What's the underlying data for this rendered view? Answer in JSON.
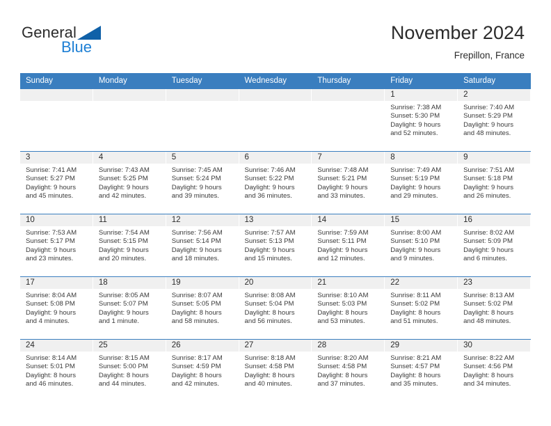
{
  "logo": {
    "word_general": "General",
    "word_blue": "Blue",
    "triangle_color": "#1061a8",
    "blue_color": "#1d7fd4"
  },
  "header": {
    "title": "November 2024",
    "subtitle": "Frepillon, France"
  },
  "theme": {
    "header_row_color": "#3a7ebf",
    "date_strip_color": "#f0f0f0",
    "text_color": "#2b2b2b"
  },
  "weekdays": [
    "Sunday",
    "Monday",
    "Tuesday",
    "Wednesday",
    "Thursday",
    "Friday",
    "Saturday"
  ],
  "labels": {
    "sunrise_prefix": "Sunrise:",
    "sunset_prefix": "Sunset:",
    "daylight_prefix": "Daylight:"
  },
  "weeks": [
    [
      {
        "date": "",
        "blank": true
      },
      {
        "date": "",
        "blank": true
      },
      {
        "date": "",
        "blank": true
      },
      {
        "date": "",
        "blank": true
      },
      {
        "date": "",
        "blank": true
      },
      {
        "date": "1",
        "sunrise": "Sunrise: 7:38 AM",
        "sunset": "Sunset: 5:30 PM",
        "daylight_1": "Daylight: 9 hours",
        "daylight_2": "and 52 minutes."
      },
      {
        "date": "2",
        "sunrise": "Sunrise: 7:40 AM",
        "sunset": "Sunset: 5:29 PM",
        "daylight_1": "Daylight: 9 hours",
        "daylight_2": "and 48 minutes."
      }
    ],
    [
      {
        "date": "3",
        "sunrise": "Sunrise: 7:41 AM",
        "sunset": "Sunset: 5:27 PM",
        "daylight_1": "Daylight: 9 hours",
        "daylight_2": "and 45 minutes."
      },
      {
        "date": "4",
        "sunrise": "Sunrise: 7:43 AM",
        "sunset": "Sunset: 5:25 PM",
        "daylight_1": "Daylight: 9 hours",
        "daylight_2": "and 42 minutes."
      },
      {
        "date": "5",
        "sunrise": "Sunrise: 7:45 AM",
        "sunset": "Sunset: 5:24 PM",
        "daylight_1": "Daylight: 9 hours",
        "daylight_2": "and 39 minutes."
      },
      {
        "date": "6",
        "sunrise": "Sunrise: 7:46 AM",
        "sunset": "Sunset: 5:22 PM",
        "daylight_1": "Daylight: 9 hours",
        "daylight_2": "and 36 minutes."
      },
      {
        "date": "7",
        "sunrise": "Sunrise: 7:48 AM",
        "sunset": "Sunset: 5:21 PM",
        "daylight_1": "Daylight: 9 hours",
        "daylight_2": "and 33 minutes."
      },
      {
        "date": "8",
        "sunrise": "Sunrise: 7:49 AM",
        "sunset": "Sunset: 5:19 PM",
        "daylight_1": "Daylight: 9 hours",
        "daylight_2": "and 29 minutes."
      },
      {
        "date": "9",
        "sunrise": "Sunrise: 7:51 AM",
        "sunset": "Sunset: 5:18 PM",
        "daylight_1": "Daylight: 9 hours",
        "daylight_2": "and 26 minutes."
      }
    ],
    [
      {
        "date": "10",
        "sunrise": "Sunrise: 7:53 AM",
        "sunset": "Sunset: 5:17 PM",
        "daylight_1": "Daylight: 9 hours",
        "daylight_2": "and 23 minutes."
      },
      {
        "date": "11",
        "sunrise": "Sunrise: 7:54 AM",
        "sunset": "Sunset: 5:15 PM",
        "daylight_1": "Daylight: 9 hours",
        "daylight_2": "and 20 minutes."
      },
      {
        "date": "12",
        "sunrise": "Sunrise: 7:56 AM",
        "sunset": "Sunset: 5:14 PM",
        "daylight_1": "Daylight: 9 hours",
        "daylight_2": "and 18 minutes."
      },
      {
        "date": "13",
        "sunrise": "Sunrise: 7:57 AM",
        "sunset": "Sunset: 5:13 PM",
        "daylight_1": "Daylight: 9 hours",
        "daylight_2": "and 15 minutes."
      },
      {
        "date": "14",
        "sunrise": "Sunrise: 7:59 AM",
        "sunset": "Sunset: 5:11 PM",
        "daylight_1": "Daylight: 9 hours",
        "daylight_2": "and 12 minutes."
      },
      {
        "date": "15",
        "sunrise": "Sunrise: 8:00 AM",
        "sunset": "Sunset: 5:10 PM",
        "daylight_1": "Daylight: 9 hours",
        "daylight_2": "and 9 minutes."
      },
      {
        "date": "16",
        "sunrise": "Sunrise: 8:02 AM",
        "sunset": "Sunset: 5:09 PM",
        "daylight_1": "Daylight: 9 hours",
        "daylight_2": "and 6 minutes."
      }
    ],
    [
      {
        "date": "17",
        "sunrise": "Sunrise: 8:04 AM",
        "sunset": "Sunset: 5:08 PM",
        "daylight_1": "Daylight: 9 hours",
        "daylight_2": "and 4 minutes."
      },
      {
        "date": "18",
        "sunrise": "Sunrise: 8:05 AM",
        "sunset": "Sunset: 5:07 PM",
        "daylight_1": "Daylight: 9 hours",
        "daylight_2": "and 1 minute."
      },
      {
        "date": "19",
        "sunrise": "Sunrise: 8:07 AM",
        "sunset": "Sunset: 5:05 PM",
        "daylight_1": "Daylight: 8 hours",
        "daylight_2": "and 58 minutes."
      },
      {
        "date": "20",
        "sunrise": "Sunrise: 8:08 AM",
        "sunset": "Sunset: 5:04 PM",
        "daylight_1": "Daylight: 8 hours",
        "daylight_2": "and 56 minutes."
      },
      {
        "date": "21",
        "sunrise": "Sunrise: 8:10 AM",
        "sunset": "Sunset: 5:03 PM",
        "daylight_1": "Daylight: 8 hours",
        "daylight_2": "and 53 minutes."
      },
      {
        "date": "22",
        "sunrise": "Sunrise: 8:11 AM",
        "sunset": "Sunset: 5:02 PM",
        "daylight_1": "Daylight: 8 hours",
        "daylight_2": "and 51 minutes."
      },
      {
        "date": "23",
        "sunrise": "Sunrise: 8:13 AM",
        "sunset": "Sunset: 5:02 PM",
        "daylight_1": "Daylight: 8 hours",
        "daylight_2": "and 48 minutes."
      }
    ],
    [
      {
        "date": "24",
        "sunrise": "Sunrise: 8:14 AM",
        "sunset": "Sunset: 5:01 PM",
        "daylight_1": "Daylight: 8 hours",
        "daylight_2": "and 46 minutes."
      },
      {
        "date": "25",
        "sunrise": "Sunrise: 8:15 AM",
        "sunset": "Sunset: 5:00 PM",
        "daylight_1": "Daylight: 8 hours",
        "daylight_2": "and 44 minutes."
      },
      {
        "date": "26",
        "sunrise": "Sunrise: 8:17 AM",
        "sunset": "Sunset: 4:59 PM",
        "daylight_1": "Daylight: 8 hours",
        "daylight_2": "and 42 minutes."
      },
      {
        "date": "27",
        "sunrise": "Sunrise: 8:18 AM",
        "sunset": "Sunset: 4:58 PM",
        "daylight_1": "Daylight: 8 hours",
        "daylight_2": "and 40 minutes."
      },
      {
        "date": "28",
        "sunrise": "Sunrise: 8:20 AM",
        "sunset": "Sunset: 4:58 PM",
        "daylight_1": "Daylight: 8 hours",
        "daylight_2": "and 37 minutes."
      },
      {
        "date": "29",
        "sunrise": "Sunrise: 8:21 AM",
        "sunset": "Sunset: 4:57 PM",
        "daylight_1": "Daylight: 8 hours",
        "daylight_2": "and 35 minutes."
      },
      {
        "date": "30",
        "sunrise": "Sunrise: 8:22 AM",
        "sunset": "Sunset: 4:56 PM",
        "daylight_1": "Daylight: 8 hours",
        "daylight_2": "and 34 minutes."
      }
    ]
  ]
}
